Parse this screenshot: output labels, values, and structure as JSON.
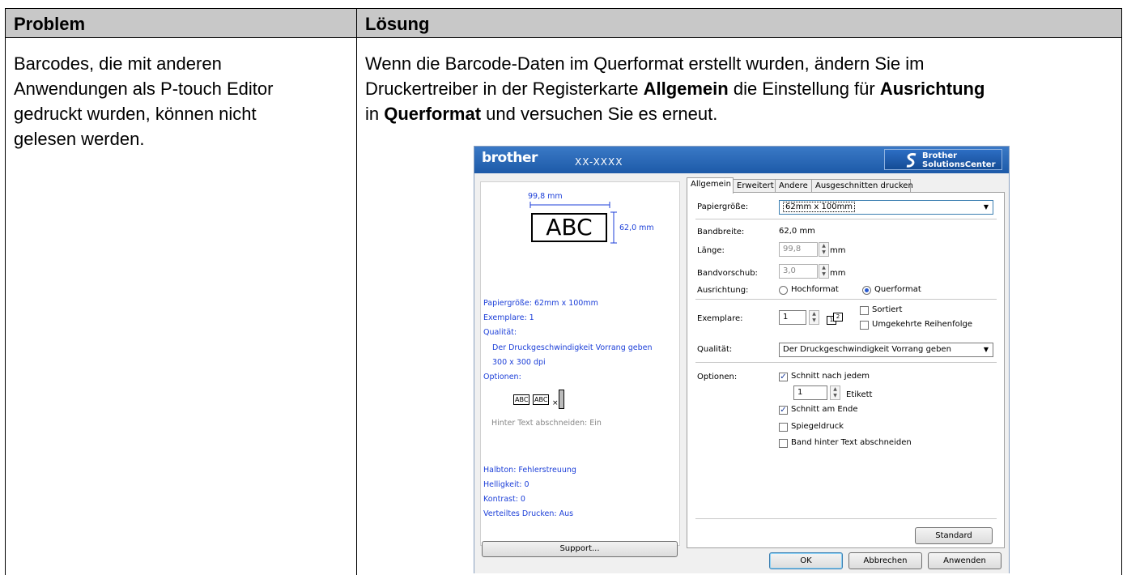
{
  "table": {
    "header": {
      "problem": "Problem",
      "solution": "Lösung"
    },
    "problem_lines": [
      "Barcodes, die mit anderen",
      "Anwendungen als P-touch Editor",
      "gedruckt wurden, können nicht",
      "gelesen werden."
    ],
    "solution": {
      "l1": "Wenn die Barcode-Daten im Querformat erstellt wurden, ändern Sie im",
      "l2a": "Druckertreiber in der Registerkarte ",
      "l2b": "Allgemein",
      "l2c": " die Einstellung für ",
      "l2d": "Ausrichtung",
      "l3a": "in ",
      "l3b": "Querformat",
      "l3c": " und versuchen Sie es erneut."
    }
  },
  "dialog": {
    "brand": "brother",
    "model": "XX-XXXX",
    "solutions_center": [
      "Brother",
      "SolutionsCenter"
    ],
    "preview": {
      "width": "99,8 mm",
      "height": "62,0 mm",
      "sample": "ABC",
      "papiergroesse": "Papiergröße: 62mm x 100mm",
      "exemplare": "Exemplare: 1",
      "qualitaet": "Qualität:",
      "qualitaet_val": "Der Druckgeschwindigkeit Vorrang geben",
      "dpi": "300 x 300 dpi",
      "optionen": "Optionen:",
      "mini_abc": "ABC",
      "hinter_text": "Hinter Text abschneiden: Ein",
      "halbton": "Halbton: Fehlerstreuung",
      "helligkeit": "Helligkeit:  0",
      "kontrast": "Kontrast:  0",
      "verteiltes": "Verteiltes Drucken: Aus",
      "support_btn": "Support..."
    },
    "tabs": [
      "Allgemein",
      "Erweitert",
      "Andere",
      "Ausgeschnitten drucken"
    ],
    "form": {
      "papiergroesse_lbl": "Papiergröße:",
      "papiergroesse_val": "62mm x 100mm",
      "bandbreite_lbl": "Bandbreite:",
      "bandbreite_val": "62,0 mm",
      "laenge_lbl": "Länge:",
      "laenge_val": "99,8",
      "unit_mm": "mm",
      "bandvorschub_lbl": "Bandvorschub:",
      "bandvorschub_val": "3,0",
      "ausrichtung_lbl": "Ausrichtung:",
      "hochformat": "Hochformat",
      "querformat": "Querformat",
      "exemplare_lbl": "Exemplare:",
      "exemplare_val": "1",
      "sortiert": "Sortiert",
      "umgekehrte": "Umgekehrte Reihenfolge",
      "qualitaet_lbl": "Qualität:",
      "qualitaet_val": "Der Druckgeschwindigkeit Vorrang geben",
      "optionen_lbl": "Optionen:",
      "schnitt_nach": "Schnitt nach jedem",
      "schnitt_count": "1",
      "etikett": "Etikett",
      "schnitt_ende": "Schnitt am Ende",
      "spiegeldruck": "Spiegeldruck",
      "band_hinter": "Band hinter Text abschneiden",
      "standard_btn": "Standard"
    },
    "buttons": {
      "ok": "OK",
      "abbrechen": "Abbrechen",
      "anwenden": "Anwenden"
    },
    "colors": {
      "title_bar": "#1d5aa8",
      "preview_text": "#1c3fd8",
      "table_header": "#c8c8c8"
    }
  }
}
